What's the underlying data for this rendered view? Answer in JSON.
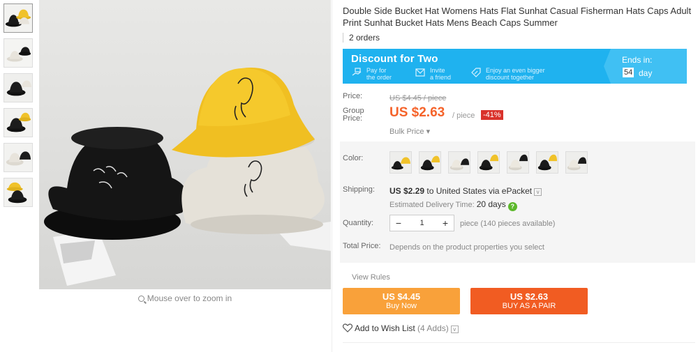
{
  "product": {
    "title": "Double Side Bucket Hat Womens Hats Flat Sunhat Casual Fisherman Hats Caps Adult Print Sunhat Bucket Hats Mens Beach Caps Summer",
    "orders": "2 orders",
    "zoom_hint": "Mouse over to zoom in"
  },
  "promo": {
    "title": "Discount for Two",
    "steps": [
      {
        "line1": "Pay for",
        "line2": "the order",
        "icon": "hand-pay-icon"
      },
      {
        "line1": "Invite",
        "line2": "a friend",
        "icon": "invite-friend-icon"
      },
      {
        "line1": "Enjoy an even bigger",
        "line2": "discount together",
        "icon": "discount-tag-icon"
      }
    ],
    "ends_label": "Ends in:",
    "ends_num": "54",
    "ends_unit": "day"
  },
  "pricing": {
    "price_label": "Price:",
    "old_price": "US $4.45 / piece",
    "group_label_1": "Group",
    "group_label_2": "Price:",
    "current_price": "US $2.63",
    "per_piece": "/ piece",
    "discount": "-41%",
    "bulk": "Bulk Price ▾"
  },
  "options": {
    "color_label": "Color:",
    "swatches": [
      "yellow-black",
      "black-yellow",
      "beige-white",
      "black-yellow-2",
      "white-beige",
      "black-yellow-3",
      "white-black"
    ],
    "shipping_label": "Shipping:",
    "shipping_price": "US $2.29",
    "shipping_to": " to United States via ePacket",
    "shipping_caret": "v",
    "delivery_label": "Estimated Delivery Time: ",
    "delivery_days": "20 days",
    "qmark": "?",
    "quantity_label": "Quantity:",
    "qty_minus": "−",
    "qty_value": "1",
    "qty_plus": "+",
    "qty_available": "piece (140 pieces available)",
    "total_label": "Total Price:",
    "total_desc": "Depends on the product properties you select"
  },
  "actions": {
    "view_rules": "View Rules",
    "buy_price": "US $4.45",
    "buy_label": "Buy Now",
    "pair_price": "US $2.63",
    "pair_label": "BUY AS A PAIR",
    "wishlist": "Add to Wish List",
    "wishlist_adds": "(4 Adds)",
    "wishlist_caret": "v"
  },
  "colors": {
    "accent_orange": "#f5632a",
    "promo_blue": "#1fb2ef",
    "buy_now": "#f9a13a",
    "buy_pair": "#f15c22",
    "discount_red": "#d9322b"
  }
}
